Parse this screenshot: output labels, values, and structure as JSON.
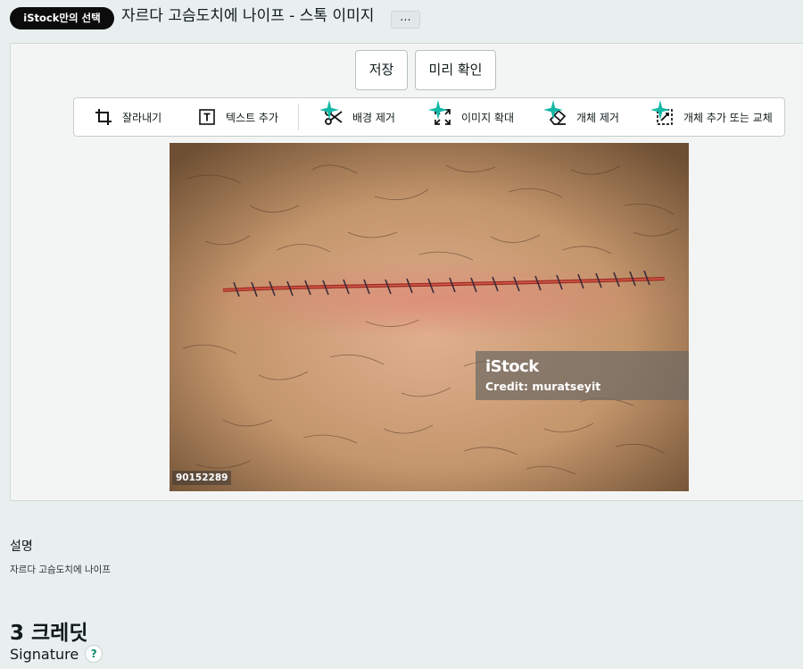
{
  "header": {
    "badge": "iStock만의 선택",
    "title": "자르다 고슴도치에 나이프 - 스톡 이미지",
    "more_label": "..."
  },
  "actions": {
    "save_label": "저장",
    "preview_label": "미리 확인"
  },
  "toolbar": {
    "tools": [
      {
        "label": "잘라내기",
        "icon": "crop-icon"
      },
      {
        "label": "텍스트 추가",
        "icon": "text-icon"
      },
      {
        "label": "배경 제거",
        "icon": "scissors-icon"
      },
      {
        "label": "이미지 확대",
        "icon": "expand-icon"
      },
      {
        "label": "개체 제거",
        "icon": "eraser-icon"
      },
      {
        "label": "개체 추가 또는 교체",
        "icon": "replace-object-icon"
      }
    ]
  },
  "image": {
    "watermark_logo": "iStock",
    "watermark_credit": "Credit: muratseyit",
    "image_id": "90152289"
  },
  "description": {
    "label": "설명",
    "text": "자르다 고슴도치에 나이프"
  },
  "pricing": {
    "credits": "3 크레딧",
    "license": "Signature",
    "help_label": "?"
  },
  "colors": {
    "page_bg": "#e9eeee",
    "badge_bg": "#0c0c0c",
    "accent_green": "#0b8a6e",
    "sparkle": "#14b8a6"
  }
}
